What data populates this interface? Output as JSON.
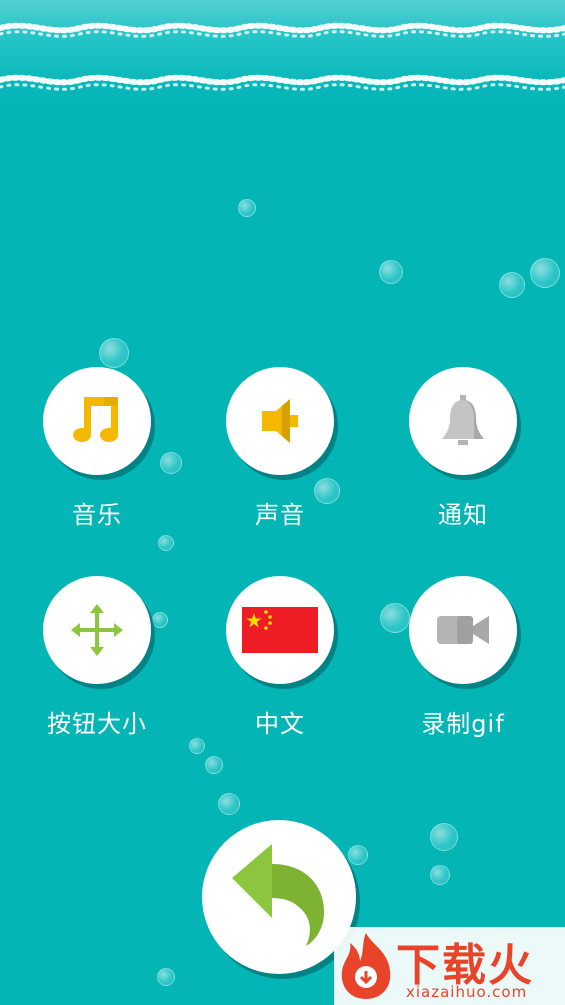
{
  "settings": {
    "items": [
      {
        "label": "音乐",
        "icon": "music-note-icon"
      },
      {
        "label": "声音",
        "icon": "speaker-icon"
      },
      {
        "label": "通知",
        "icon": "bell-icon"
      },
      {
        "label": "按钮大小",
        "icon": "move-arrows-icon"
      },
      {
        "label": "中文",
        "icon": "china-flag-icon"
      },
      {
        "label": "录制gif",
        "icon": "video-camera-icon"
      }
    ],
    "back_icon": "back-arrow-icon"
  },
  "watermark": {
    "title": "下载火",
    "url": "xiazaihuo.com"
  },
  "colors": {
    "background": "#03b5b5",
    "icon_yellow": "#f5b800",
    "icon_gray": "#b4b4b4",
    "icon_green": "#8cc63f",
    "flag_red": "#ee1c25",
    "flag_star": "#ffde00",
    "watermark": "#e8442a"
  }
}
